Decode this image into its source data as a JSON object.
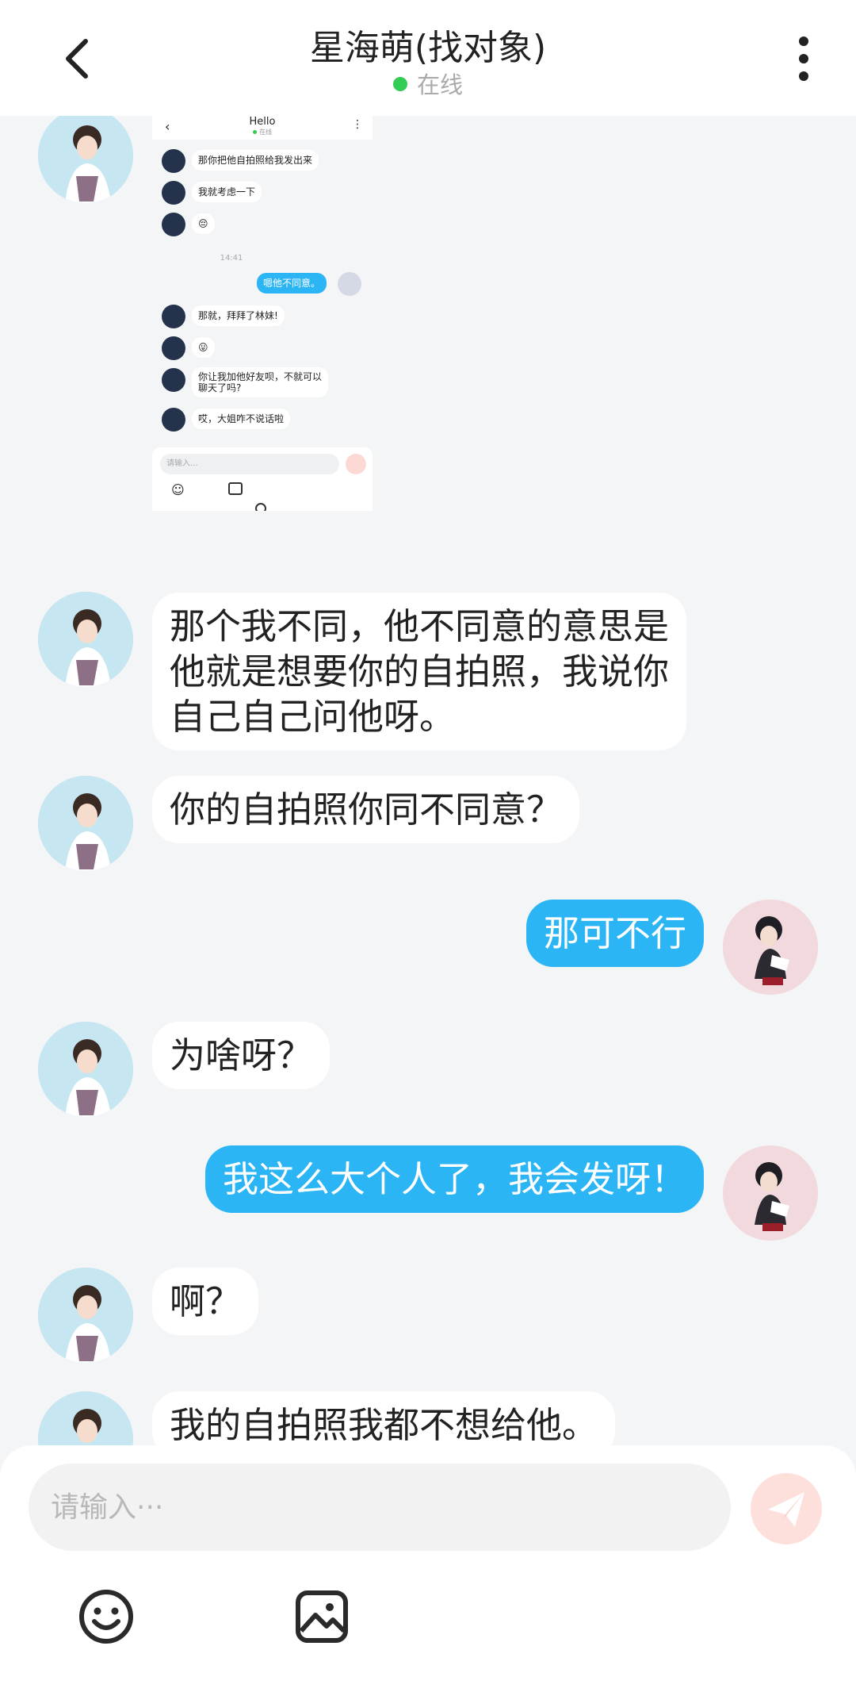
{
  "header": {
    "title": "星海萌(找对象)",
    "status": "在线",
    "status_color": "#33cc55",
    "back_icon": "chevron-left-icon",
    "more_icon": "more-vertical-icon"
  },
  "embedded_screenshot": {
    "title": "Hello",
    "status": "在线",
    "messages": [
      {
        "side": "in",
        "text": "那你把他自拍照给我发出来"
      },
      {
        "side": "in",
        "text": "我就考虑一下"
      },
      {
        "side": "in",
        "text": "😔"
      },
      {
        "side": "time",
        "text": "14:41"
      },
      {
        "side": "out",
        "text": "嗯他不同意。"
      },
      {
        "side": "in",
        "text": "那就，拜拜了林妹!"
      },
      {
        "side": "in",
        "text": "😛"
      },
      {
        "side": "in",
        "text": "你让我加他好友呗，不就可以聊天了吗?",
        "line1": "你让我加他好友呗，不就可以",
        "line2": "聊天了吗?"
      },
      {
        "side": "in",
        "text": "哎，大姐咋不说话啦"
      }
    ],
    "input_placeholder": "请输入..."
  },
  "messages": [
    {
      "side": "in",
      "lines": [
        "那个我不同，他不同意的意思是",
        "他就是想要你的自拍照，我说你",
        "自己自己问他呀。"
      ]
    },
    {
      "side": "in",
      "lines": [
        "你的自拍照你同不同意？"
      ]
    },
    {
      "side": "out",
      "lines": [
        "那可不行"
      ]
    },
    {
      "side": "in",
      "lines": [
        "为啥呀？"
      ]
    },
    {
      "side": "out",
      "lines": [
        "我这么大个人了，我会发呀！"
      ]
    },
    {
      "side": "in",
      "lines": [
        "啊？"
      ]
    },
    {
      "side": "in",
      "lines": [
        "我的自拍照我都不想给他。"
      ]
    }
  ],
  "input": {
    "placeholder": "请输入···",
    "send_icon": "send-plane-icon",
    "emoji_icon": "smiley-icon",
    "image_icon": "image-icon"
  },
  "colors": {
    "outgoing_bubble": "#2bb5f5",
    "incoming_bubble": "#ffffff",
    "background": "#f3f5f7"
  }
}
